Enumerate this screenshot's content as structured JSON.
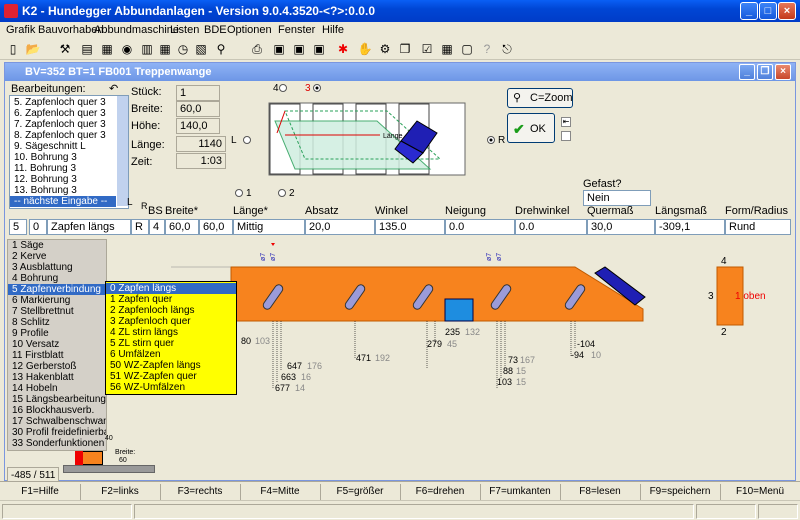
{
  "window": {
    "title": "K2 - Hundegger Abbundanlagen - Version 9.0.4.3520-<?>:0.0.0"
  },
  "menu": [
    "Grafik",
    "Bauvorhaben",
    "Abbundmaschine",
    "Listen",
    "BDE",
    "Optionen",
    "Fenster",
    "Hilfe"
  ],
  "inner": {
    "title": "BV=352  BT=1 FB001 Treppenwange"
  },
  "bearbeitungen": {
    "label": "Bearbeitungen:",
    "items": [
      "5. Zapfenloch quer 3",
      "6. Zapfenloch quer 3",
      "7. Zapfenloch quer 3",
      "8. Zapfenloch quer 3",
      "9. Sägeschnitt L",
      "10. Bohrung 3",
      "11. Bohrung 3",
      "12. Bohrung 3",
      "13. Bohrung 3",
      "-- nächste Eingabe --"
    ],
    "selected_index": 9
  },
  "dims": {
    "stueck_label": "Stück:",
    "stueck": "1",
    "breite_label": "Breite:",
    "breite": "60,0",
    "hoehe_label": "Höhe:",
    "hoehe": "140,0",
    "laenge_label": "Länge:",
    "laenge": "1140",
    "zeit_label": "Zeit:",
    "zeit": "1:03"
  },
  "preview": {
    "side_L": "L",
    "side_R": "R",
    "pos_top_4": "4",
    "pos_top_3": "3",
    "pos_bottom_1": "1",
    "pos_bottom_2": "2",
    "lange_tag": "Länge"
  },
  "buttons": {
    "zoom": "C=Zoom",
    "ok": "OK"
  },
  "gefast": {
    "label": "Gefast?",
    "value": "Nein"
  },
  "params": {
    "col_headers": [
      "BS",
      "Breite*",
      "Länge*",
      "Absatz",
      "Winkel",
      "Neigung",
      "Drehwinkel",
      "Quermaß",
      "Längsmaß",
      "Form/Radius"
    ],
    "l_label": "L",
    "l_value": "5",
    "r_label": "R",
    "gruppe_value": "0",
    "typ_value": "Zapfen längs",
    "bs_value": "R",
    "bs_num": "4",
    "breite1": "60,0",
    "breite2": "60,0",
    "laenge": "Mittig",
    "absatz": "20,0",
    "winkel": "135.0",
    "neigung": "0.0",
    "drehwinkel": "0.0",
    "quermass": "30,0",
    "laengsmass": "-309,1",
    "form": "Rund"
  },
  "categories": {
    "items": [
      "1 Säge",
      "2 Kerve",
      "3 Ausblattung",
      "4 Bohrung",
      "5 Zapfenverbindung",
      "6 Markierung",
      "7 Stellbrettnut",
      "8 Schlitz",
      "9 Profile",
      "10 Versatz",
      "11 Firstblatt",
      "12 Gerberstoß",
      "13 Hakenblatt",
      "14 Hobeln",
      "15 Längsbearbeitungen",
      "16 Blockhausverb.",
      "17 Schwalbenschwanz",
      "30 Profil freidefinierbar",
      "33 Sonderfunktionen"
    ],
    "selected_index": 4
  },
  "subtypes": {
    "items": [
      "0 Zapfen längs",
      "1 Zapfen quer",
      "2 Zapfenloch längs",
      "3 Zapfenloch quer",
      "4 ZL stirn längs",
      "5 ZL stirn quer",
      "6 Umfälzen",
      "50 WZ-Zapfen längs",
      "51 WZ-Zapfen quer",
      "56 WZ-Umfälzen"
    ],
    "selected_index": 0
  },
  "drawing": {
    "dims_black": [
      "80",
      "471",
      "235",
      "279",
      "647",
      "663",
      "677",
      "73",
      "88",
      "103",
      "-104",
      "-94"
    ],
    "dims_grey": [
      "103",
      "192",
      "132",
      "45",
      "176",
      "16",
      "14",
      "167",
      "15",
      "15",
      "10"
    ],
    "top_marks": [
      "ø7",
      "ø7",
      "ø7",
      "ø7"
    ]
  },
  "mini": {
    "top": "4",
    "left": "3",
    "bottom": "2",
    "label": "1 oben"
  },
  "section": {
    "breite_label": "Breite:",
    "breite": "60",
    "height": "40",
    "pos": "-485 / 511"
  },
  "fkeys": [
    "F1=Hilfe",
    "F2=links",
    "F3=rechts",
    "F4=Mitte",
    "F5=größer",
    "F6=drehen",
    "F7=umkanten",
    "F8=lesen",
    "F9=speichern",
    "F10=Menü"
  ],
  "colors": {
    "beam": "#f7831e",
    "tool": "#1f1fb4",
    "hole": "#9b9bd8",
    "yellow": "#ffff00",
    "list_sel": "#316ac5"
  }
}
